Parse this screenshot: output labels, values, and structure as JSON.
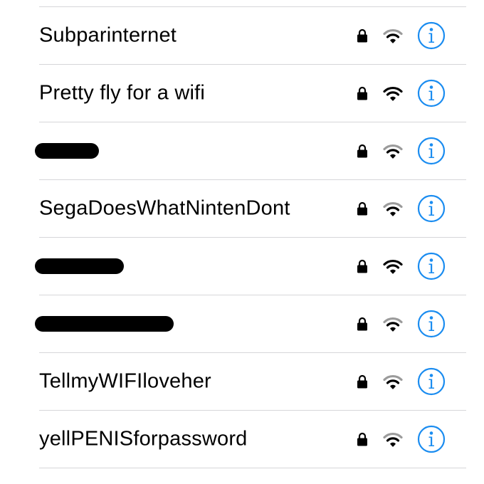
{
  "colors": {
    "accent": "#1a8cf0",
    "divider": "#d6d6d9",
    "text": "#000000",
    "wifi_strong": "#000000",
    "wifi_weak": "#9b9b9b"
  },
  "networks": [
    {
      "name": "Subparinternet",
      "secured": true,
      "signal": "medium",
      "redacted": false
    },
    {
      "name": "Pretty fly for a wifi",
      "secured": true,
      "signal": "full",
      "redacted": false
    },
    {
      "name": "",
      "secured": true,
      "signal": "medium",
      "redacted": true
    },
    {
      "name": "SegaDoesWhatNintenDont",
      "secured": true,
      "signal": "medium",
      "redacted": false
    },
    {
      "name": "",
      "secured": true,
      "signal": "full",
      "redacted": true
    },
    {
      "name": "",
      "secured": true,
      "signal": "medium",
      "redacted": true
    },
    {
      "name": "TellmyWIFIloveher",
      "secured": true,
      "signal": "medium",
      "redacted": false
    },
    {
      "name": "yellPENISforpassword",
      "secured": true,
      "signal": "medium",
      "redacted": false
    }
  ],
  "icons": {
    "lock": "lock-icon",
    "wifi": "wifi-icon",
    "info": "info-icon"
  }
}
